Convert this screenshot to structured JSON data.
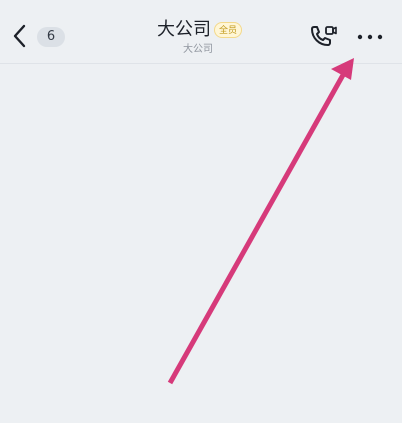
{
  "header": {
    "back_icon": "chevron-left-icon",
    "unread_count": "6",
    "title": "大公司",
    "member_tag": "全员",
    "subtitle": "大公司",
    "call_icon": "phone-video-icon",
    "more_icon": "more-horizontal-icon"
  },
  "annotation": {
    "arrow_color": "#d63a7a"
  }
}
